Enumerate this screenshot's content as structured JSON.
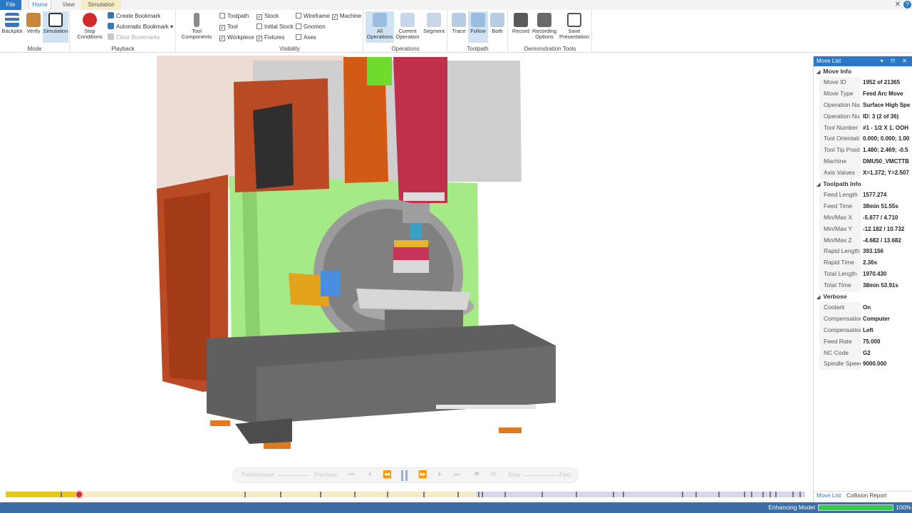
{
  "tabs": {
    "file": "File",
    "home": "Home",
    "view": "View",
    "simulation": "Simulation"
  },
  "window": {
    "close_glyph": "✕",
    "help_glyph": "?"
  },
  "ribbon": {
    "mode": {
      "label": "Mode",
      "backplot": "Backplot",
      "verify": "Verify",
      "simulation": "Simulation"
    },
    "playback": {
      "label": "Playback",
      "stop_conditions": "Stop Conditions",
      "create_bookmark": "Create Bookmark",
      "automatic_bookmark": "Automatic Bookmark",
      "clear_bookmarks": "Clear Bookmarks"
    },
    "tool_components": "Tool Components",
    "visibility": {
      "label": "Visibility",
      "toolpath": "Toolpath",
      "tool": "Tool",
      "workpiece": "Workpiece",
      "stock": "Stock",
      "initial_stock": "Initial Stock",
      "fixtures": "Fixtures",
      "wireframe": "Wireframe",
      "gnomon": "Gnomon",
      "axes": "Axes",
      "machine": "Machine"
    },
    "operations": {
      "label": "Operations",
      "all": "All Operations",
      "current": "Current Operation",
      "segment": "Segment"
    },
    "toolpath": {
      "label": "Toolpath",
      "trace": "Trace",
      "follow": "Follow",
      "both": "Both"
    },
    "demo": {
      "label": "Demonstration Tools",
      "record": "Record",
      "recording_options": "Recording Options",
      "save_presentation": "Save Presentation"
    }
  },
  "playback_bar": {
    "performance": "Performance",
    "precision": "Precision",
    "slow": "Slow",
    "fast": "Fast"
  },
  "timeline": {
    "progress_fraction": 0.091
  },
  "status": {
    "text": "Enhancing Model",
    "percent": "100%",
    "progress_fraction": 1.0
  },
  "panel": {
    "title": "Move List",
    "controls": "▾ ⊓ ✕",
    "sections": [
      {
        "title": "Move Info",
        "rows": [
          {
            "k": "Move ID",
            "v": "1952 of 21365"
          },
          {
            "k": "Move Type",
            "v": "Feed Arc Move"
          },
          {
            "k": "Operation Na",
            "v": "Surface High Spe"
          },
          {
            "k": "Operation Nu",
            "v": "ID: 3 (2 of 36)"
          },
          {
            "k": "Tool Number",
            "v": "#1 - 1/2 X 1. OOH"
          },
          {
            "k": "Tool Orientati",
            "v": "0.000; 0.000; 1.00"
          },
          {
            "k": "Tool Tip Posit",
            "v": "1.480; 2.469; -0.5"
          },
          {
            "k": "Machine",
            "v": "DMU50_VMCTTB"
          },
          {
            "k": "Axis Values",
            "v": "X=1.372; Y=2.507"
          }
        ]
      },
      {
        "title": "Toolpath Info",
        "rows": [
          {
            "k": "Feed Length",
            "v": "1577.274"
          },
          {
            "k": "Feed Time",
            "v": "38min 51.55s"
          },
          {
            "k": "Min/Max X",
            "v": "-5.877 / 4.710"
          },
          {
            "k": "Min/Max Y",
            "v": "-12.182 / 10.732"
          },
          {
            "k": "Min/Max Z",
            "v": "-4.682 / 13.682"
          },
          {
            "k": "Rapid Length",
            "v": "393.156"
          },
          {
            "k": "Rapid Time",
            "v": "2.36s"
          },
          {
            "k": "Total Length",
            "v": "1970.430"
          },
          {
            "k": "Total Time",
            "v": "38min 53.91s"
          }
        ]
      },
      {
        "title": "Verbose",
        "rows": [
          {
            "k": "Coolant",
            "v": "On"
          },
          {
            "k": "Compensation",
            "v": "Computer"
          },
          {
            "k": "Compensation",
            "v": "Left"
          },
          {
            "k": "Feed Rate",
            "v": "75.000"
          },
          {
            "k": "NC Code",
            "v": "G2"
          },
          {
            "k": "Spindle Speec",
            "v": "9000.000"
          }
        ]
      }
    ],
    "tabs": {
      "move_list": "Move List",
      "collision_report": "Collision Report"
    }
  }
}
